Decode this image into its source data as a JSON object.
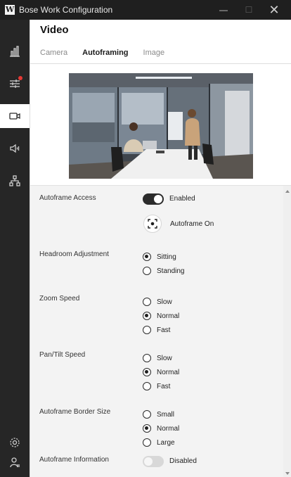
{
  "window": {
    "logo_letter": "W",
    "title": "Bose Work Configuration",
    "minimize_glyph": "—",
    "maximize_glyph": "☐",
    "close_glyph": "✕"
  },
  "sidebar": {
    "items": [
      {
        "icon": "bar-chart-icon",
        "active": false
      },
      {
        "icon": "sliders-icon",
        "active": false,
        "badge": true
      },
      {
        "icon": "video-camera-icon",
        "active": true
      },
      {
        "icon": "speaker-icon",
        "active": false
      },
      {
        "icon": "network-icon",
        "active": false
      },
      {
        "icon": "gear-icon",
        "active": false
      },
      {
        "icon": "user-icon",
        "active": false
      }
    ]
  },
  "page": {
    "title": "Video",
    "tabs": [
      {
        "label": "Camera",
        "active": false
      },
      {
        "label": "Autoframing",
        "active": true
      },
      {
        "label": "Image",
        "active": false
      }
    ]
  },
  "settings": {
    "autoframe_access": {
      "label": "Autoframe Access",
      "toggle_on": true,
      "state_text": "Enabled",
      "button_label": "Autoframe On",
      "button_icon": "autoframe-target-icon"
    },
    "headroom": {
      "label": "Headroom Adjustment",
      "options": [
        "Sitting",
        "Standing"
      ],
      "selected": "Sitting"
    },
    "zoom_speed": {
      "label": "Zoom Speed",
      "options": [
        "Slow",
        "Normal",
        "Fast"
      ],
      "selected": "Normal"
    },
    "pan_tilt_speed": {
      "label": "Pan/Tilt Speed",
      "options": [
        "Slow",
        "Normal",
        "Fast"
      ],
      "selected": "Normal"
    },
    "border_size": {
      "label": "Autoframe Border Size",
      "options": [
        "Small",
        "Normal",
        "Large"
      ],
      "selected": "Normal"
    },
    "autoframe_info": {
      "label": "Autoframe Information",
      "toggle_on": false,
      "state_text": "Disabled"
    }
  },
  "colors": {
    "sidebar_bg": "#262626",
    "titlebar_bg": "#1f1f1f",
    "settings_bg": "#f3f3f3",
    "badge": "#e53935",
    "toggle_on": "#2b2b2b"
  }
}
